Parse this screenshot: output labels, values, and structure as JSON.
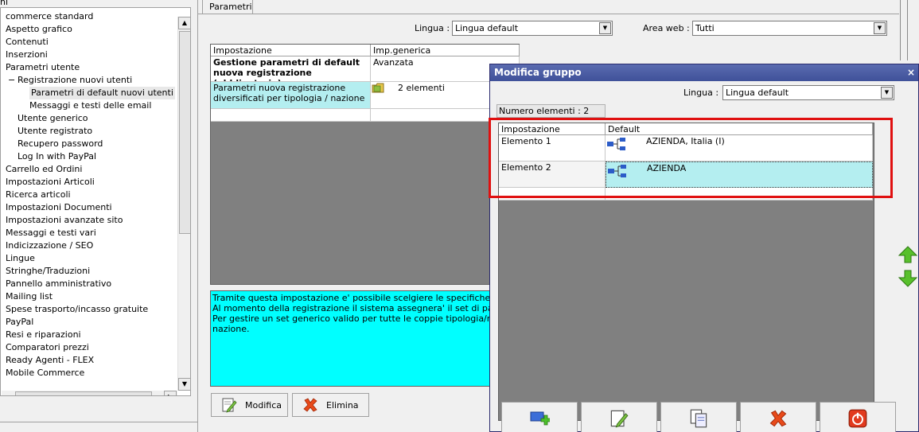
{
  "tree": {
    "header_label": "ni",
    "items": [
      {
        "label": "commerce standard",
        "level": 0
      },
      {
        "label": "Aspetto grafico",
        "level": 0
      },
      {
        "label": "Contenuti",
        "level": 0
      },
      {
        "label": "Inserzioni",
        "level": 0
      },
      {
        "label": "Parametri utente",
        "level": 0
      },
      {
        "label": "Registrazione nuovi utenti",
        "level": 1,
        "expander": "−"
      },
      {
        "label": "Parametri di default nuovi utenti",
        "level": 2,
        "selected": true
      },
      {
        "label": "Messaggi e testi delle email",
        "level": 2
      },
      {
        "label": "Utente generico",
        "level": 1
      },
      {
        "label": "Utente registrato",
        "level": 1
      },
      {
        "label": "Recupero password",
        "level": 1
      },
      {
        "label": "Log In with PayPal",
        "level": 1
      },
      {
        "label": "Carrello ed Ordini",
        "level": 0
      },
      {
        "label": "Impostazioni Articoli",
        "level": 0
      },
      {
        "label": "Ricerca articoli",
        "level": 0
      },
      {
        "label": "Impostazioni Documenti",
        "level": 0
      },
      {
        "label": "Impostazioni avanzate sito",
        "level": 0
      },
      {
        "label": "Messaggi e testi vari",
        "level": 0
      },
      {
        "label": "Indicizzazione / SEO",
        "level": 0
      },
      {
        "label": "Lingue",
        "level": 0
      },
      {
        "label": "Stringhe/Traduzioni",
        "level": 0
      },
      {
        "label": "Pannello amministrativo",
        "level": 0
      },
      {
        "label": "Mailing list",
        "level": 0
      },
      {
        "label": "Spese trasporto/incasso gratuite",
        "level": 0
      },
      {
        "label": "PayPal",
        "level": 0
      },
      {
        "label": "Resi e riparazioni",
        "level": 0
      },
      {
        "label": "Comparatori prezzi",
        "level": 0
      },
      {
        "label": "Ready Agenti - FLEX",
        "level": 0
      },
      {
        "label": "Mobile Commerce",
        "level": 0
      }
    ]
  },
  "main": {
    "tab_label": "Parametri",
    "lingua_label": "Lingua :",
    "lingua_value": "Lingua default",
    "area_label": "Area web :",
    "area_value": "Tutti",
    "grid": {
      "columns": [
        "Impostazione",
        "Imp.generica"
      ],
      "rows": [
        {
          "setting": "Gestione parametri di default nuova registrazione (obbligatorio)",
          "value": "Avanzata"
        },
        {
          "setting": "Parametri nuova registrazione diversificati per tipologia / nazione",
          "value": "2 elementi"
        }
      ]
    },
    "description_lines": [
      "Tramite questa impostazione e' possibile scelgiere le specifiche per i nuovi",
      "Al momento della registrazione il sistema assegnera' il set di parametri del",
      "Per gestire un set generico valido per tutte le coppie tipologia/nazione (ne",
      "nazione."
    ],
    "btn_modifica": "Modifica",
    "btn_elimina": "Elimina"
  },
  "dialog": {
    "title": "Modifica gruppo",
    "close": "×",
    "lingua_label": "Lingua :",
    "lingua_value": "Lingua default",
    "count_label": "Numero elementi : 2",
    "columns": [
      "Impostazione",
      "Default"
    ],
    "rows": [
      {
        "name": "Elemento 1",
        "value": "AZIENDA, Italia (I)"
      },
      {
        "name": "Elemento 2",
        "value": "AZIENDA"
      }
    ]
  },
  "colors": {
    "highlight_cyan": "#00ffff",
    "row_cyan": "#b4eef0",
    "dialog_title": "#3f5199",
    "annotation_red": "#e01010"
  }
}
